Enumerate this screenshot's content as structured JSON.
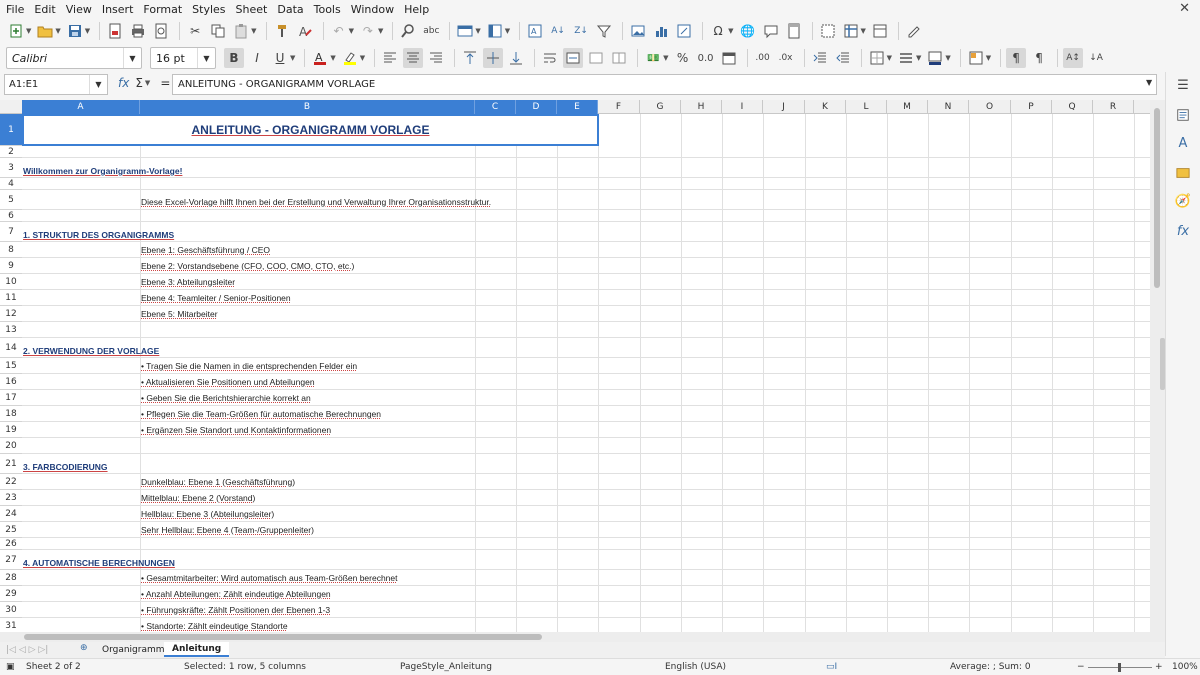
{
  "menu": [
    "File",
    "Edit",
    "View",
    "Insert",
    "Format",
    "Styles",
    "Sheet",
    "Data",
    "Tools",
    "Window",
    "Help"
  ],
  "font": {
    "name": "Calibri",
    "size": "16 pt"
  },
  "namebox": "A1:E1",
  "formula_value": "ANLEITUNG - ORGANIGRAMM VORLAGE",
  "columns": [
    "A",
    "B",
    "C",
    "D",
    "E",
    "F",
    "G",
    "H",
    "I",
    "J",
    "K",
    "L",
    "M",
    "N",
    "O",
    "P",
    "Q",
    "R"
  ],
  "title": "ANLEITUNG - ORGANIGRAMM VORLAGE",
  "rows": [
    {
      "n": "1"
    },
    {
      "n": "2"
    },
    {
      "n": "3",
      "a": "Willkommen zur Organigramm-Vorlage!"
    },
    {
      "n": "4"
    },
    {
      "n": "5",
      "b": "Diese Excel-Vorlage hilft Ihnen bei der Erstellung und Verwaltung Ihrer Organisationsstruktur."
    },
    {
      "n": "6"
    },
    {
      "n": "7",
      "a": "1. STRUKTUR DES ORGANIGRAMMS"
    },
    {
      "n": "8",
      "b": "Ebene 1: Geschäftsführung / CEO"
    },
    {
      "n": "9",
      "b": "Ebene 2: Vorstandsebene (CFO, COO, CMO, CTO, etc.)"
    },
    {
      "n": "10",
      "b": "Ebene 3: Abteilungsleiter"
    },
    {
      "n": "11",
      "b": "Ebene 4: Teamleiter / Senior-Positionen"
    },
    {
      "n": "12",
      "b": "Ebene 5: Mitarbeiter"
    },
    {
      "n": "13"
    },
    {
      "n": "14",
      "a": "2. VERWENDUNG DER VORLAGE"
    },
    {
      "n": "15",
      "b": "• Tragen Sie die Namen in die entsprechenden Felder ein"
    },
    {
      "n": "16",
      "b": "• Aktualisieren Sie Positionen und Abteilungen"
    },
    {
      "n": "17",
      "b": "• Geben Sie die Berichtshierarchie korrekt an"
    },
    {
      "n": "18",
      "b": "• Pflegen Sie die Team-Größen für automatische Berechnungen"
    },
    {
      "n": "19",
      "b": "• Ergänzen Sie Standort und Kontaktinformationen"
    },
    {
      "n": "20"
    },
    {
      "n": "21",
      "a": "3. FARBCODIERUNG"
    },
    {
      "n": "22",
      "b": "Dunkelblau: Ebene 1 (Geschäftsführung)"
    },
    {
      "n": "23",
      "b": "Mittelblau: Ebene 2 (Vorstand)"
    },
    {
      "n": "24",
      "b": "Hellblau: Ebene 3 (Abteilungsleiter)"
    },
    {
      "n": "25",
      "b": "Sehr Hellblau: Ebene 4 (Team-/Gruppenleiter)"
    },
    {
      "n": "26"
    },
    {
      "n": "27",
      "a": "4. AUTOMATISCHE BERECHNUNGEN"
    },
    {
      "n": "28",
      "b": "• Gesamtmitarbeiter: Wird automatisch aus Team-Größen berechnet"
    },
    {
      "n": "29",
      "b": "• Anzahl Abteilungen: Zählt eindeutige Abteilungen"
    },
    {
      "n": "30",
      "b": "• Führungskräfte: Zählt Positionen der Ebenen 1-3"
    },
    {
      "n": "31",
      "b": "• Standorte: Zählt eindeutige Standorte"
    }
  ],
  "tabs": [
    "Organigramm",
    "Anleitung"
  ],
  "status": {
    "sheet": "Sheet 2 of 2",
    "selection": "Selected: 1 row, 5 columns",
    "page_style": "PageStyle_Anleitung",
    "language": "English (USA)",
    "sum": "Average: ; Sum: 0",
    "zoom": "100%"
  }
}
